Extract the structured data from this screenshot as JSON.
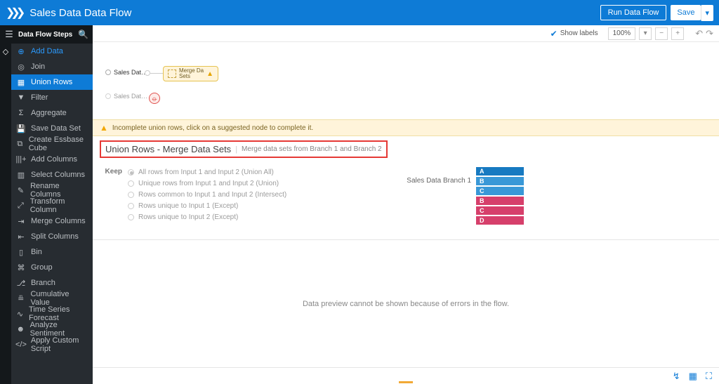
{
  "app": {
    "title": "Sales Data Data Flow",
    "run_label": "Run Data Flow",
    "save_label": "Save"
  },
  "sidebar": {
    "header": "Data Flow Steps",
    "items": [
      {
        "label": "Add Data"
      },
      {
        "label": "Join"
      },
      {
        "label": "Union Rows"
      },
      {
        "label": "Filter"
      },
      {
        "label": "Aggregate"
      },
      {
        "label": "Save Data Set"
      },
      {
        "label": "Create Essbase Cube"
      },
      {
        "label": "Add Columns"
      },
      {
        "label": "Select Columns"
      },
      {
        "label": "Rename Columns"
      },
      {
        "label": "Transform Column"
      },
      {
        "label": "Merge Columns"
      },
      {
        "label": "Split Columns"
      },
      {
        "label": "Bin"
      },
      {
        "label": "Group"
      },
      {
        "label": "Branch"
      },
      {
        "label": "Cumulative Value"
      },
      {
        "label": "Time Series Forecast"
      },
      {
        "label": "Analyze Sentiment"
      },
      {
        "label": "Apply Custom Script"
      }
    ]
  },
  "toolbar": {
    "show_labels": "Show labels",
    "zoom": "100%"
  },
  "canvas": {
    "node1": "Sales Dat…",
    "node2": "Sales Dat…",
    "merge": "Merge Da\nSets"
  },
  "warning": "Incomplete union rows, click on a suggested node to complete it.",
  "union": {
    "title": "Union Rows - Merge Data Sets",
    "subtitle": "Merge data sets from Branch 1 and Branch 2",
    "keep_label": "Keep",
    "options": [
      "All rows from Input 1 and Input 2 (Union All)",
      "Unique rows from Input 1 and Input 2 (Union)",
      "Rows common to Input 1 and Input 2 (Intersect)",
      "Rows unique to Input 1 (Except)",
      "Rows unique to Input 2 (Except)"
    ],
    "preview_label": "Sales Data Branch 1",
    "blue": [
      "A",
      "B",
      "C"
    ],
    "pink": [
      "B",
      "C",
      "D"
    ]
  },
  "preview": {
    "message": "Data preview cannot be shown because of errors in the flow."
  }
}
